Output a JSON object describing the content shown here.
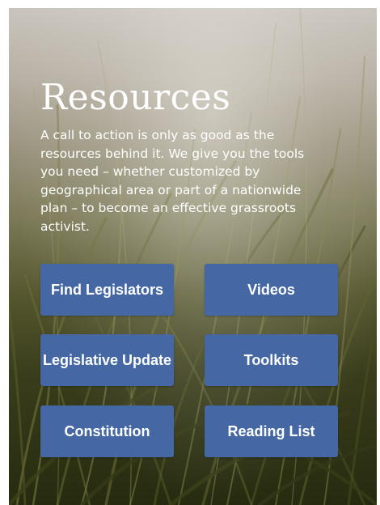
{
  "resources": {
    "title": "Resources",
    "description": "A call to action is only as good as the resources behind it. We give you the tools you need – whether customized by geographical area or part of a nationwide plan – to become an effective grassroots activist.",
    "buttons": [
      {
        "label": "Find Legislators"
      },
      {
        "label": "Videos"
      },
      {
        "label": "Legislative Update"
      },
      {
        "label": "Toolkits"
      },
      {
        "label": "Constitution"
      },
      {
        "label": "Reading List"
      }
    ]
  },
  "colors": {
    "button_bg": "#4568a4",
    "text": "#ffffff"
  }
}
